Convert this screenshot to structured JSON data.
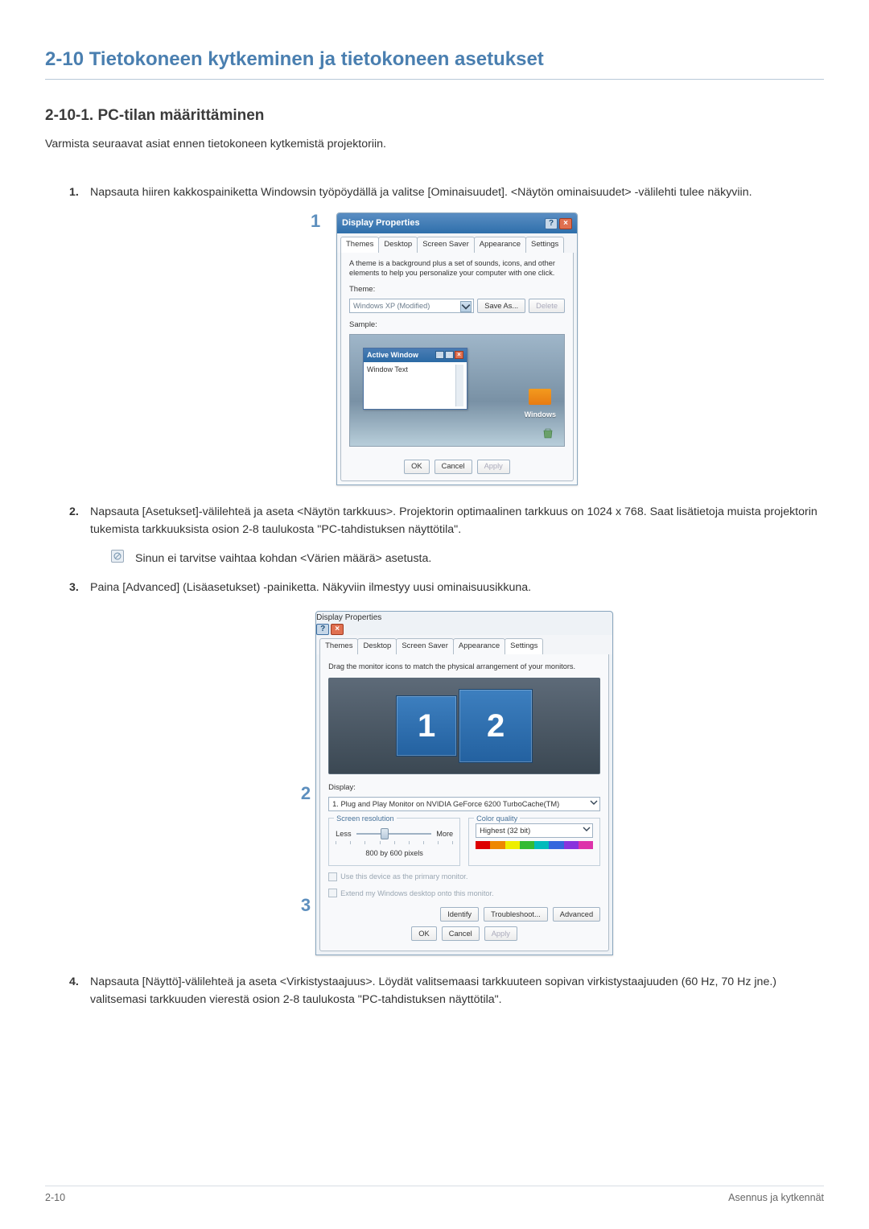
{
  "heading": "2-10  Tietokoneen kytkeminen ja tietokoneen asetukset",
  "subheading": "2-10-1. PC-tilan määrittäminen",
  "intro": "Varmista seuraavat asiat ennen tietokoneen kytkemistä projektoriin.",
  "steps": {
    "s1": "Napsauta hiiren kakkospainiketta Windowsin työpöydällä ja valitse [Ominaisuudet]. <Näytön ominaisuudet> -välilehti tulee näkyviin.",
    "s2": "Napsauta [Asetukset]-välilehteä ja aseta <Näytön tarkkuus>. Projektorin optimaalinen tarkkuus on 1024 x 768. Saat lisätietoja muista projektorin tukemista tarkkuuksista osion 2-8 taulukosta \"PC-tahdistuksen näyttötila\".",
    "note": "Sinun ei tarvitse vaihtaa kohdan <Värien määrä> asetusta.",
    "s3": "Paina [Advanced] (Lisäasetukset) -painiketta. Näkyviin ilmestyy uusi ominaisuusikkuna.",
    "s4": "Napsauta [Näyttö]-välilehteä ja aseta <Virkistystaajuus>. Löydät valitsemaasi tarkkuuteen sopivan virkistystaajuuden (60 Hz, 70 Hz jne.) valitsemasi tarkkuuden vierestä osion 2-8 taulukosta \"PC-tahdistuksen näyttötila\"."
  },
  "overlay_1": "1",
  "dlg1": {
    "title": "Display Properties",
    "help": "?",
    "close": "×",
    "tabs": {
      "themes": "Themes",
      "desktop": "Desktop",
      "screensaver": "Screen Saver",
      "appearance": "Appearance",
      "settings": "Settings"
    },
    "desc": "A theme is a background plus a set of sounds, icons, and other elements to help you personalize your computer with one click.",
    "theme_label": "Theme:",
    "theme_value": "Windows XP (Modified)",
    "save_as": "Save As...",
    "delete": "Delete",
    "sample_label": "Sample:",
    "aw_title": "Active Window",
    "aw_text": "Window Text",
    "logo_text": "Windows",
    "ok": "OK",
    "cancel": "Cancel",
    "apply": "Apply"
  },
  "overlay_2": "2",
  "overlay_3": "3",
  "dlg2": {
    "title": "Display Properties",
    "help": "?",
    "close": "×",
    "tabs": {
      "themes": "Themes",
      "desktop": "Desktop",
      "screensaver": "Screen Saver",
      "appearance": "Appearance",
      "settings": "Settings"
    },
    "drag_hint": "Drag the monitor icons to match the physical arrangement of your monitors.",
    "mon1": "1",
    "mon2": "2",
    "display_label": "Display:",
    "display_value": "1. Plug and Play Monitor on NVIDIA GeForce 6200 TurboCache(TM)",
    "sr_label": "Screen resolution",
    "less": "Less",
    "more": "More",
    "res_value": "800 by 600  pixels",
    "cq_label": "Color quality",
    "cq_value": "Highest (32 bit)",
    "chk1": "Use this device as the primary monitor.",
    "chk2": "Extend my Windows desktop onto this monitor.",
    "identify": "Identify",
    "troubleshoot": "Troubleshoot...",
    "advanced": "Advanced",
    "ok": "OK",
    "cancel": "Cancel",
    "apply": "Apply"
  },
  "footer": {
    "left": "2-10",
    "right": "Asennus ja kytkennät"
  }
}
